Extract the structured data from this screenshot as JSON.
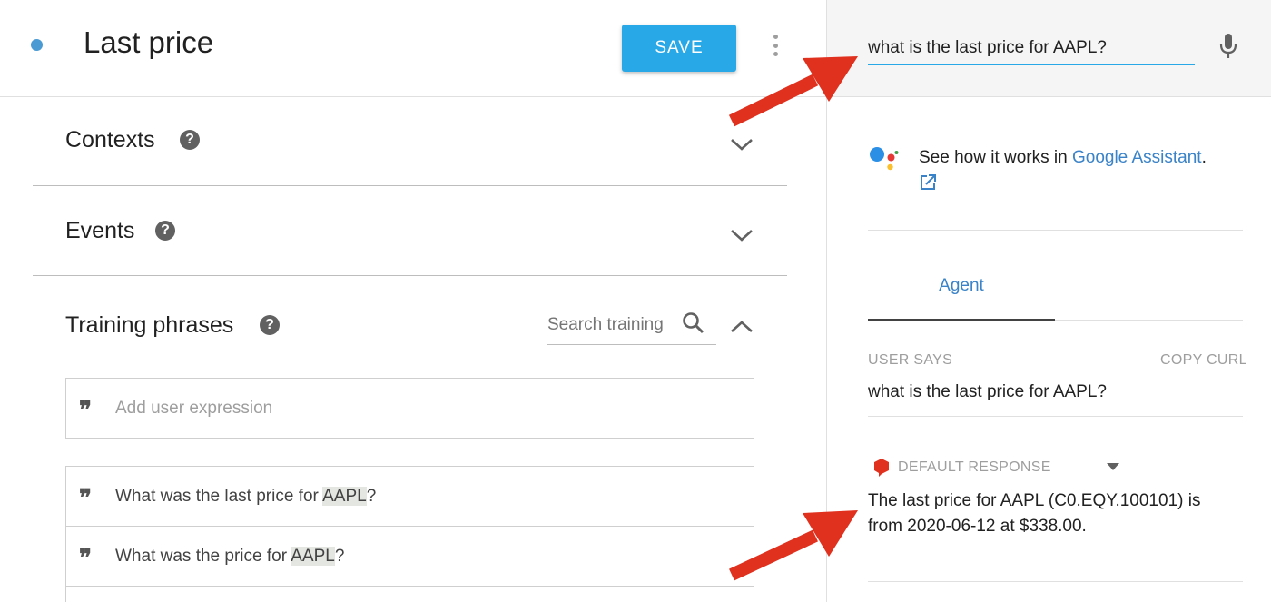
{
  "intent": {
    "title": "Last price",
    "save_label": "SAVE"
  },
  "sections": {
    "contexts": "Contexts",
    "events": "Events",
    "training": "Training phrases",
    "search_placeholder": "Search training"
  },
  "training_phrases": {
    "add_placeholder": "Add user expression",
    "items": [
      {
        "before": "What was the last price for ",
        "entity": "AAPL",
        "after": "?"
      },
      {
        "before": "What was the price for ",
        "entity": "AAPL",
        "after": "?"
      }
    ]
  },
  "simulator": {
    "query": "what is the last price for AAPL?",
    "assistant_prefix": "See how it works in ",
    "assistant_link": "Google Assistant",
    "assistant_suffix": ".",
    "tab_agent": "Agent",
    "user_says_label": "USER SAYS",
    "copy_curl_label": "COPY CURL",
    "user_says_value": "what is the last price for AAPL?",
    "default_response_label": "DEFAULT RESPONSE",
    "response_line1": "The last price for AAPL (C0.EQY.100101) is",
    "response_line2": "from 2020-06-12 at $338.00."
  },
  "colors": {
    "accent": "#29a8e8",
    "link": "#3a83c8",
    "arrow": "#e0301e"
  },
  "icons": [
    "dot-icon",
    "more-vert-icon",
    "help-icon",
    "chevron-down-icon",
    "chevron-up-icon",
    "search-icon",
    "quote-icon",
    "mic-icon",
    "google-assistant-icon",
    "external-link-icon",
    "response-bubble-icon",
    "dropdown-icon"
  ]
}
